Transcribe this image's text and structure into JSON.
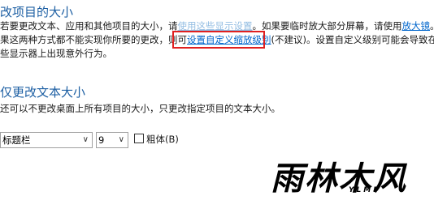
{
  "section1": {
    "heading": "改项目的大小",
    "line1_pre": "若要更改文本、应用和其他项目的大小，请",
    "line1_link1": "使用这些显示设置",
    "line1_mid": "。如果要临时放大部分屏幕，请使用",
    "line1_link2": "放大镜",
    "line1_end": "。如",
    "line2_pre": "果这两种方式都不能实现你所要的更改，则可",
    "line2_link": "设置自定义缩放级别",
    "line2_post": "(不建议)。设置自定义级别可能会导致在某",
    "line3": "些显示器上出现意外行为。"
  },
  "section2": {
    "heading": "仅更改文本大小",
    "desc": "还可以不更改桌面上所有项目的大小，只更改指定项目的文本大小。",
    "item_select_value": "标题栏",
    "size_select_value": "9",
    "bold_label": "粗体(B)"
  },
  "watermark": {
    "main": "雨林木风",
    "sub": "YLMF"
  }
}
